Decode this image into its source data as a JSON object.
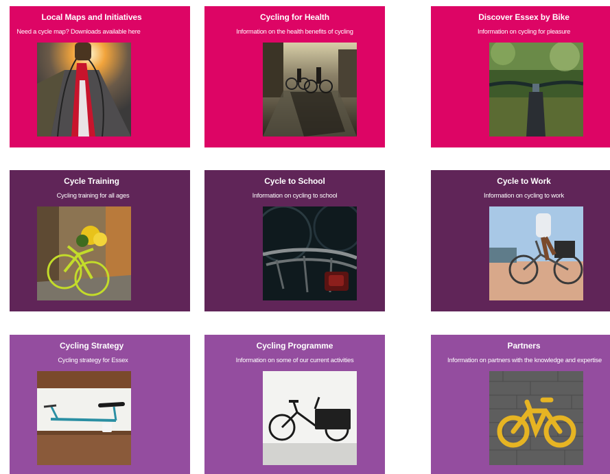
{
  "colors": {
    "row1": "#dd0565",
    "row2": "#602558",
    "row3": "#944d9f",
    "text": "#ffffff"
  },
  "cards": [
    {
      "title": "Local Maps and Initiatives",
      "description": "Need a cycle map?  Downloads available here",
      "image": "sunset-road-cycling-image"
    },
    {
      "title": "Cycling for Health",
      "description": "Information on the health benefits of cycling",
      "image": "city-street-cyclists-image"
    },
    {
      "title": "Discover Essex by Bike",
      "description": "Information on cycling for pleasure",
      "image": "handlebars-park-image"
    },
    {
      "title": "Cycle Training",
      "description": "Cycling training for all ages",
      "image": "yellow-bike-flowers-image"
    },
    {
      "title": "Cycle to School",
      "description": "Information on cycling to school",
      "image": "bike-rear-rack-image"
    },
    {
      "title": "Cycle to Work",
      "description": "Information on cycling to work",
      "image": "commuter-cyclist-image"
    },
    {
      "title": "Cycling Strategy",
      "description": "Cycling strategy for Essex",
      "image": "blue-bike-wall-image"
    },
    {
      "title": "Cycling Programme",
      "description": "Information on some of our current activities",
      "image": "cargo-bike-image"
    },
    {
      "title": "Partners",
      "description": "Information on partners with the knowledge and expertise",
      "image": "bike-lane-symbol-image"
    }
  ]
}
